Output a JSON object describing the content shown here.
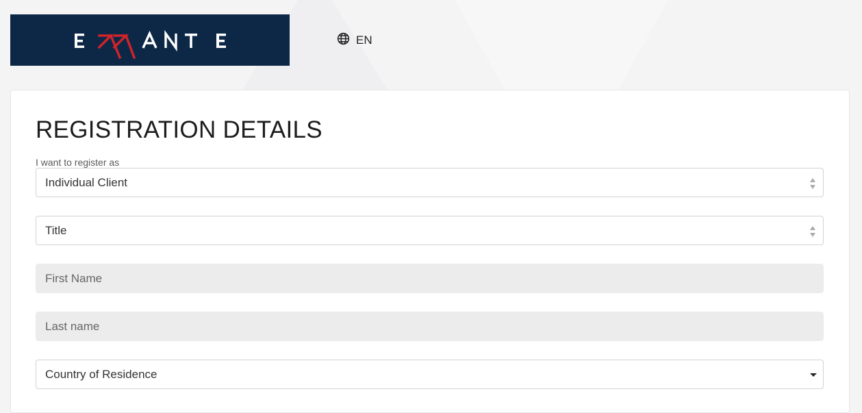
{
  "header": {
    "logo_text": "ERRANTE",
    "language_label": "EN",
    "icons": {
      "language": "globe-icon"
    }
  },
  "form": {
    "title": "REGISTRATION DETAILS",
    "register_as_label": "I want to register as",
    "register_as_value": "Individual Client",
    "title_select_value": "Title",
    "first_name_placeholder": "First Name",
    "last_name_placeholder": "Last name",
    "country_select_value": "Country of Residence"
  },
  "colors": {
    "brand_navy": "#0d2847",
    "accent_red": "#d2232a",
    "input_fill": "#ececec"
  }
}
